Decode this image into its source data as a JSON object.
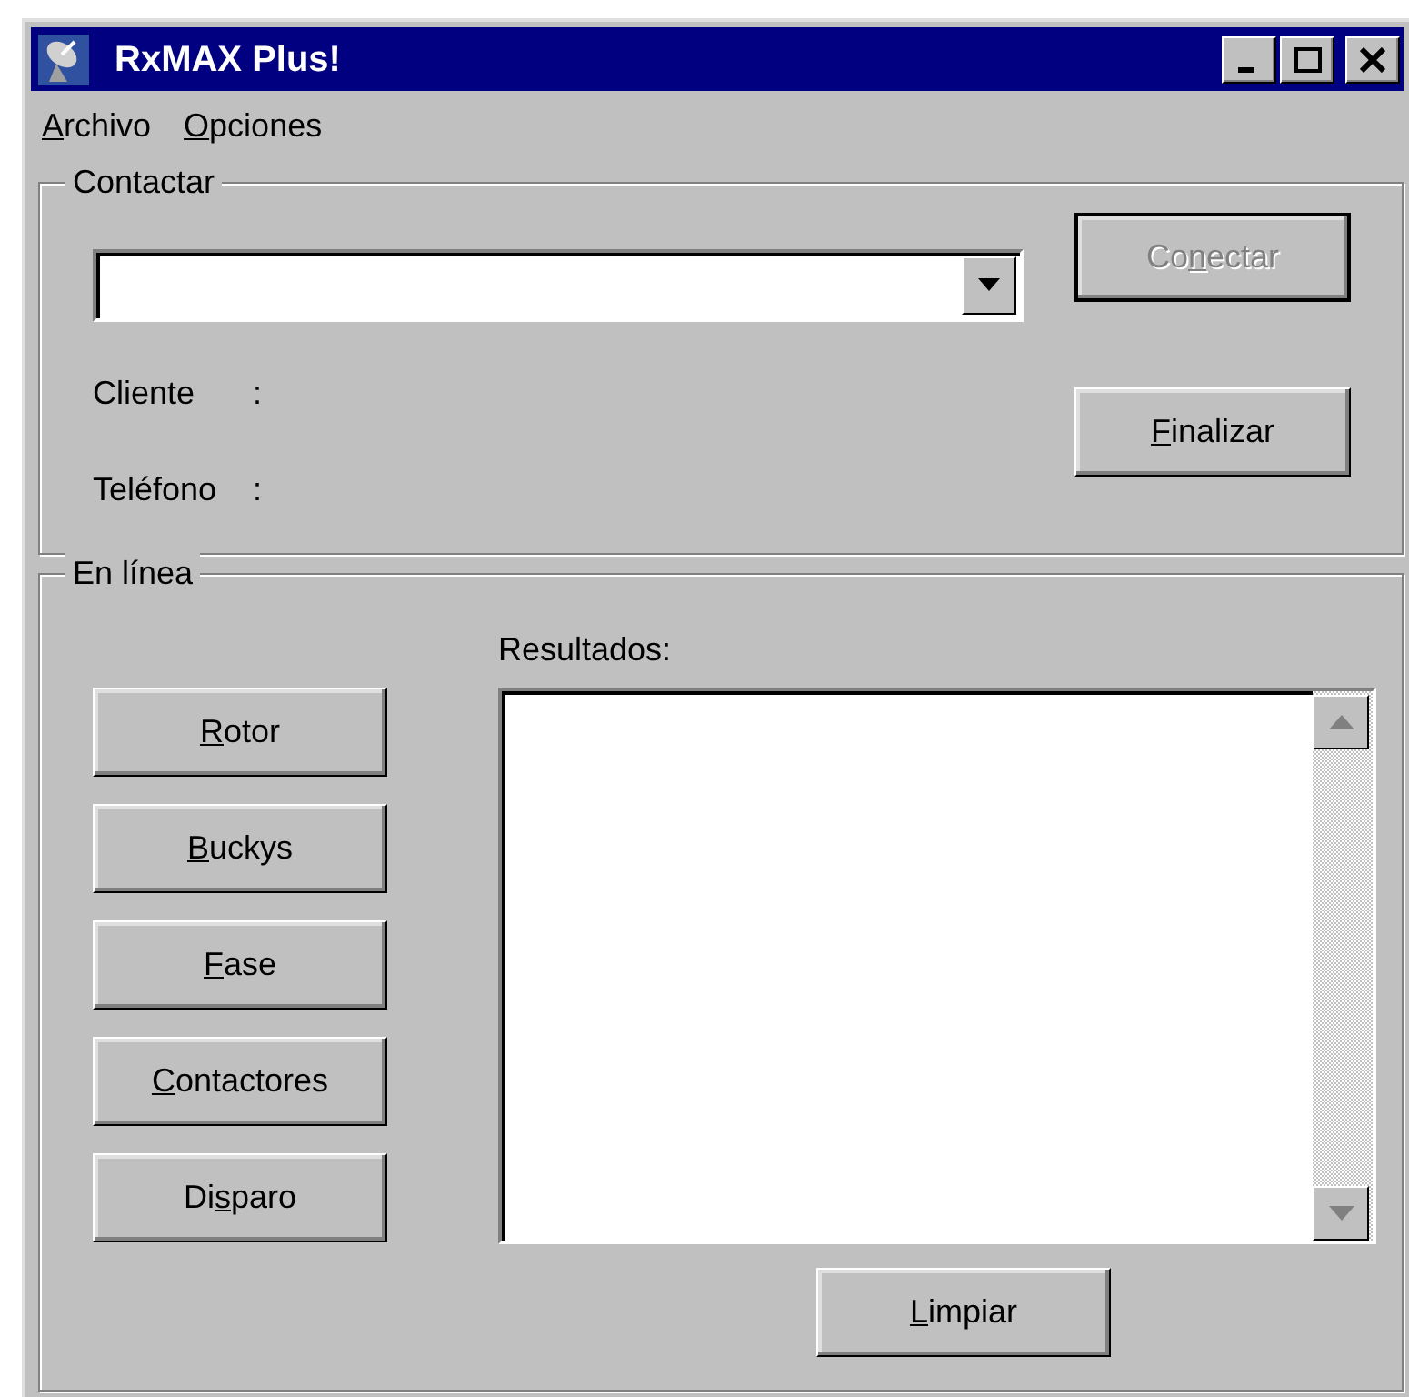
{
  "window": {
    "title": "RxMAX Plus!"
  },
  "menu": [
    {
      "key": "A",
      "post": "rchivo"
    },
    {
      "key": "O",
      "post": "pciones"
    }
  ],
  "contact_group": {
    "title": "Contactar",
    "fields": [
      {
        "label": "Cliente",
        "separator": ":"
      },
      {
        "label": "Teléfono",
        "separator": ":"
      }
    ],
    "buttons": [
      {
        "pre": "Co",
        "key": "n",
        "post": "ectar",
        "disabled": true,
        "default": true
      },
      {
        "key": "F",
        "post": "inalizar",
        "disabled": false,
        "default": false
      }
    ]
  },
  "online_group": {
    "title": "En línea",
    "results_label": "Resultados:",
    "buttons": [
      {
        "key": "R",
        "post": "otor",
        "disabled": false,
        "default": false
      },
      {
        "key": "B",
        "post": "uckys",
        "disabled": false,
        "default": false
      },
      {
        "key": "F",
        "post": "ase",
        "disabled": false,
        "default": false
      },
      {
        "key": "C",
        "post": "ontactores",
        "disabled": false,
        "default": false
      },
      {
        "pre": "Di",
        "key": "s",
        "post": "paro",
        "disabled": false,
        "default": false
      }
    ],
    "clear_button": {
      "key": "L",
      "post": "impiar",
      "disabled": false,
      "default": false
    }
  }
}
